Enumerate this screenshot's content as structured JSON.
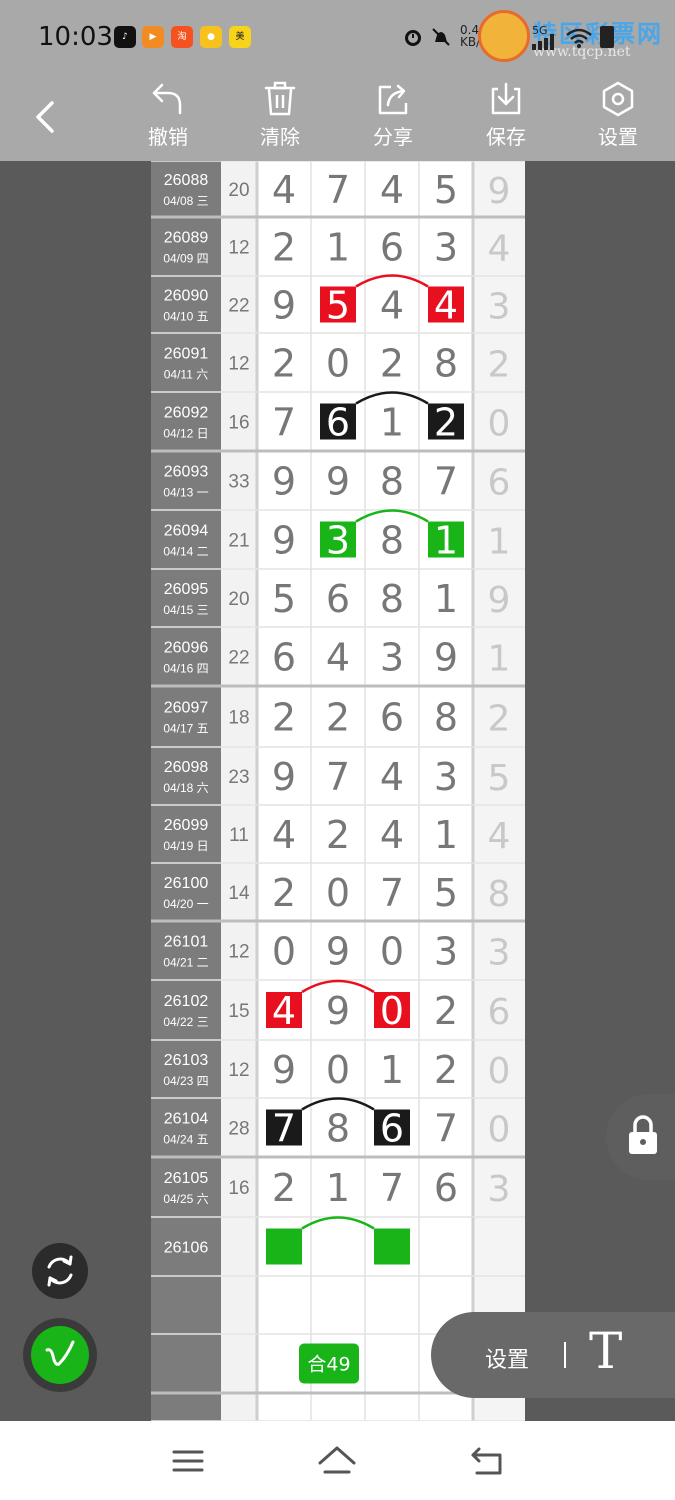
{
  "status": {
    "time": "10:03",
    "net_speed": "0.41",
    "net_unit": "KB/s",
    "signal": "5G",
    "apps": [
      "tiktok-icon",
      "video-icon",
      "taobao-icon",
      "delivery-icon",
      "meituan-icon"
    ]
  },
  "watermark": {
    "name": "特区彩票网",
    "url": "www.tqcp.net"
  },
  "toolbar": {
    "undo": "撤销",
    "clear": "清除",
    "share": "分享",
    "save": "保存",
    "settings": "设置"
  },
  "rows": [
    {
      "id": "26088",
      "date": "04/08 三",
      "sum": "20",
      "d": [
        4,
        7,
        4,
        5
      ],
      "tail": "9"
    },
    {
      "id": "26089",
      "date": "04/09 四",
      "sum": "12",
      "d": [
        2,
        1,
        6,
        3
      ],
      "tail": "4"
    },
    {
      "id": "26090",
      "date": "04/10 五",
      "sum": "22",
      "d": [
        9,
        5,
        4,
        4
      ],
      "tail": "3"
    },
    {
      "id": "26091",
      "date": "04/11 六",
      "sum": "12",
      "d": [
        2,
        0,
        2,
        8
      ],
      "tail": "2"
    },
    {
      "id": "26092",
      "date": "04/12 日",
      "sum": "16",
      "d": [
        7,
        6,
        1,
        2
      ],
      "tail": "0"
    },
    {
      "id": "26093",
      "date": "04/13 一",
      "sum": "33",
      "d": [
        9,
        9,
        8,
        7
      ],
      "tail": "6"
    },
    {
      "id": "26094",
      "date": "04/14 二",
      "sum": "21",
      "d": [
        9,
        3,
        8,
        1
      ],
      "tail": "1"
    },
    {
      "id": "26095",
      "date": "04/15 三",
      "sum": "20",
      "d": [
        5,
        6,
        8,
        1
      ],
      "tail": "9"
    },
    {
      "id": "26096",
      "date": "04/16 四",
      "sum": "22",
      "d": [
        6,
        4,
        3,
        9
      ],
      "tail": "1"
    },
    {
      "id": "26097",
      "date": "04/17 五",
      "sum": "18",
      "d": [
        2,
        2,
        6,
        8
      ],
      "tail": "2"
    },
    {
      "id": "26098",
      "date": "04/18 六",
      "sum": "23",
      "d": [
        9,
        7,
        4,
        3
      ],
      "tail": "5"
    },
    {
      "id": "26099",
      "date": "04/19 日",
      "sum": "11",
      "d": [
        4,
        2,
        4,
        1
      ],
      "tail": "4"
    },
    {
      "id": "26100",
      "date": "04/20 一",
      "sum": "14",
      "d": [
        2,
        0,
        7,
        5
      ],
      "tail": "8"
    },
    {
      "id": "26101",
      "date": "04/21 二",
      "sum": "12",
      "d": [
        0,
        9,
        0,
        3
      ],
      "tail": "3"
    },
    {
      "id": "26102",
      "date": "04/22 三",
      "sum": "15",
      "d": [
        4,
        9,
        0,
        2
      ],
      "tail": "6"
    },
    {
      "id": "26103",
      "date": "04/23 四",
      "sum": "12",
      "d": [
        9,
        0,
        1,
        2
      ],
      "tail": "0"
    },
    {
      "id": "26104",
      "date": "04/24 五",
      "sum": "28",
      "d": [
        7,
        8,
        6,
        7
      ],
      "tail": "0"
    },
    {
      "id": "26105",
      "date": "04/25 六",
      "sum": "16",
      "d": [
        2,
        1,
        7,
        6
      ],
      "tail": "3"
    },
    {
      "id": "26106",
      "date": "",
      "sum": "",
      "d": [],
      "tail": ""
    }
  ],
  "highlights": [
    {
      "row": 2,
      "cols": [
        1,
        3
      ],
      "color": "#e8101e"
    },
    {
      "row": 4,
      "cols": [
        1,
        3
      ],
      "color": "#1a1a1a"
    },
    {
      "row": 6,
      "cols": [
        1,
        3
      ],
      "color": "#18b418"
    },
    {
      "row": 14,
      "cols": [
        0,
        2
      ],
      "color": "#e8101e"
    },
    {
      "row": 16,
      "cols": [
        0,
        2
      ],
      "color": "#1a1a1a"
    },
    {
      "row": 18,
      "cols": [
        0,
        2
      ],
      "color": "#18b418",
      "empty": true
    }
  ],
  "badge": {
    "label": "合49",
    "color": "#18b418"
  },
  "settings_pill": {
    "label": "设置",
    "icon": "text-T-icon",
    "glyph": "T"
  },
  "colors": {
    "red": "#e8101e",
    "black": "#1a1a1a",
    "green": "#18b418",
    "date_col": "#7c7c7c"
  }
}
